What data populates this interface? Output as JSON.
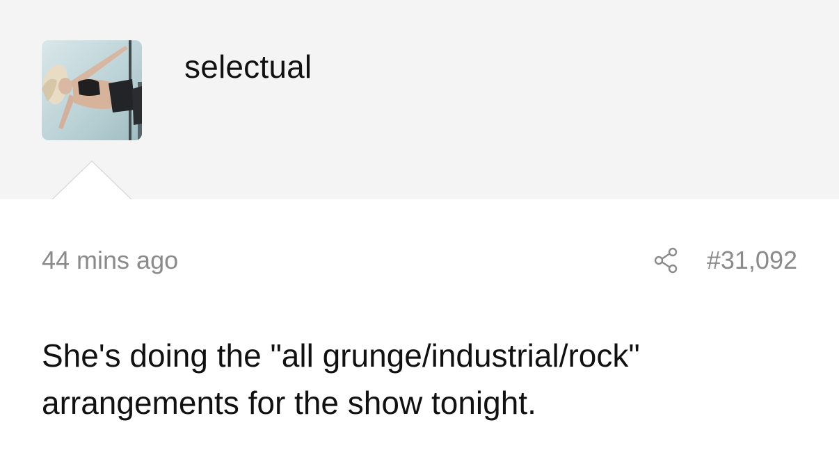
{
  "post": {
    "username": "selectual",
    "timestamp": "44 mins ago",
    "post_number": "#31,092",
    "body": "She's doing the \"all grunge/industrial/rock\" arrangements for the show tonight.",
    "icons": {
      "share": "share-icon",
      "avatar": "avatar-image"
    }
  },
  "colors": {
    "header_bg": "#f4f4f4",
    "body_bg": "#ffffff",
    "muted_text": "#8a8a8a",
    "primary_text": "#111111"
  }
}
